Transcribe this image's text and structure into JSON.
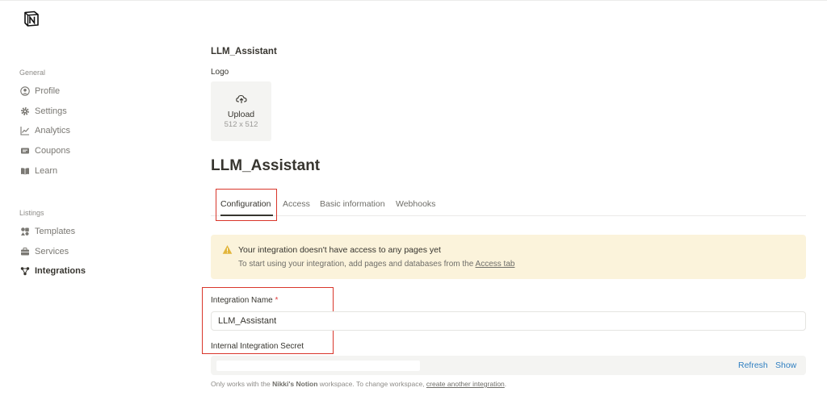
{
  "sidebar": {
    "general_heading": "General",
    "general_items": [
      {
        "label": "Profile",
        "icon": "profile-icon"
      },
      {
        "label": "Settings",
        "icon": "gear-icon"
      },
      {
        "label": "Analytics",
        "icon": "analytics-icon"
      },
      {
        "label": "Coupons",
        "icon": "coupon-icon"
      },
      {
        "label": "Learn",
        "icon": "book-icon"
      }
    ],
    "listings_heading": "Listings",
    "listings_items": [
      {
        "label": "Templates",
        "icon": "templates-icon"
      },
      {
        "label": "Services",
        "icon": "briefcase-icon"
      },
      {
        "label": "Integrations",
        "icon": "integrations-icon",
        "active": true
      }
    ]
  },
  "integration": {
    "name_header": "LLM_Assistant",
    "logo_label": "Logo",
    "upload_label": "Upload",
    "upload_size": "512 x 512",
    "title": "LLM_Assistant"
  },
  "tabs": [
    {
      "label": "Configuration",
      "active": true
    },
    {
      "label": "Access"
    },
    {
      "label": "Basic information"
    },
    {
      "label": "Webhooks"
    }
  ],
  "alert": {
    "title": "Your integration doesn't have access to any pages yet",
    "text_prefix": "To start using your integration, add pages and databases from the ",
    "link": "Access tab"
  },
  "form": {
    "name_label": "Integration Name",
    "required_mark": "*",
    "name_value": "LLM_Assistant",
    "secret_label": "Internal Integration Secret",
    "refresh_label": "Refresh",
    "show_label": "Show"
  },
  "footnote": {
    "prefix": "Only works with the ",
    "workspace": "Nikki's Notion",
    "middle": " workspace. To change workspace, ",
    "link": "create another integration",
    "suffix": "."
  },
  "colors": {
    "highlight": "#d9362b",
    "alert_bg": "#fbf3db",
    "link_blue": "#2f7fc1"
  }
}
